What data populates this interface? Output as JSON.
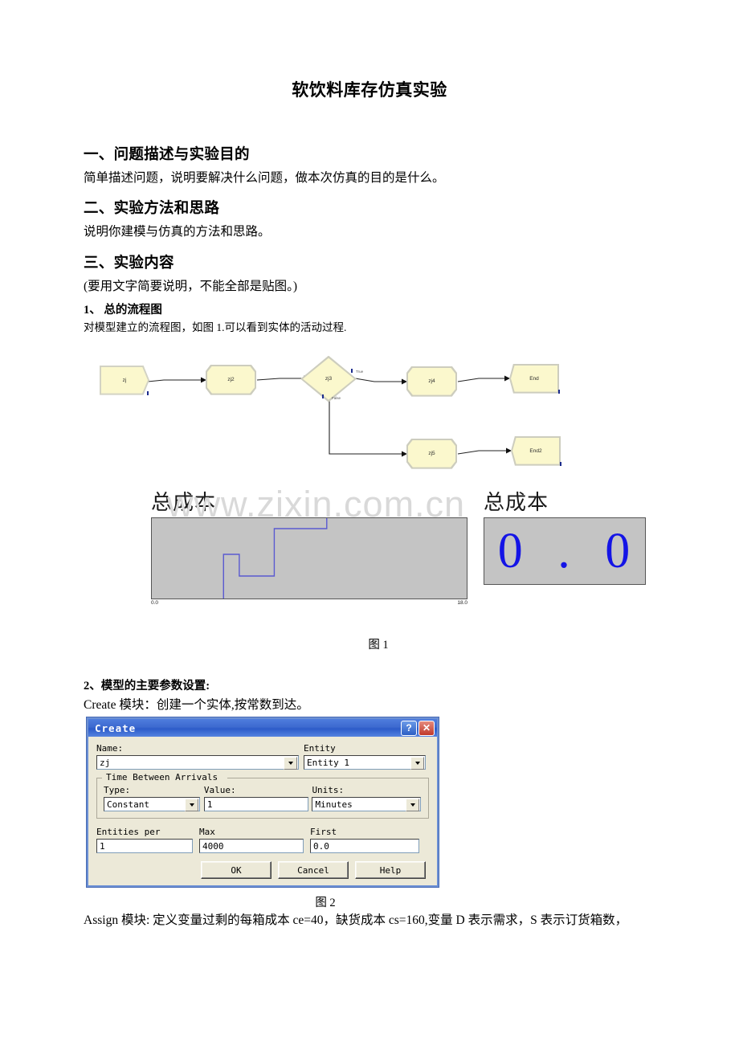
{
  "document": {
    "title": "软饮料库存仿真实验",
    "sections": [
      {
        "heading": "一、问题描述与实验目的",
        "body": "简单描述问题，说明要解决什么问题，做本次仿真的目的是什么。"
      },
      {
        "heading": "二、实验方法和思路",
        "body": "说明你建模与仿真的方法和思路。"
      },
      {
        "heading": "三、实验内容",
        "body": "(要用文字简要说明，不能全部是贴图。)"
      }
    ],
    "item1_heading": "1、  总的流程图",
    "item1_body": "对模型建立的流程图，如图 1.可以看到实体的活动过程.",
    "figure1_caption": "图 1",
    "item2_heading": "2、模型的主要参数设置:",
    "item2_body": "Create 模块：创建一个实体,按常数到达。",
    "figure2_caption": "图 2",
    "assign_body": "Assign 模块: 定义变量过剩的每箱成本 ce=40，缺货成本 cs=160,变量 D 表示需求，S 表示订货箱数，"
  },
  "watermark": "www.zixin.com.cn",
  "flowchart": {
    "nodes": [
      {
        "id": "zj",
        "label": "zj",
        "shape": "create"
      },
      {
        "id": "zj2",
        "label": "zj2",
        "shape": "octagon"
      },
      {
        "id": "zj3",
        "label": "zj3",
        "shape": "diamond"
      },
      {
        "id": "zj4",
        "label": "zj4",
        "shape": "octagon"
      },
      {
        "id": "end",
        "label": "End",
        "shape": "dispose"
      },
      {
        "id": "zj5",
        "label": "zj5",
        "shape": "octagon"
      },
      {
        "id": "end2",
        "label": "End2",
        "shape": "dispose"
      }
    ],
    "port_labels": {
      "true": "True",
      "false": "False"
    },
    "fill_color": "#fbf8cd",
    "edge_color": "#9a9a86"
  },
  "chart_data": {
    "type": "line",
    "title": "总成本",
    "xlabel": "",
    "ylabel": "",
    "xlim": [
      0.0,
      18.0
    ],
    "x_tick_labels": [
      "0.0",
      "18.0"
    ],
    "grid": false,
    "legend": "none",
    "line_color": "#5a5ad0",
    "plot_background": "#c4c4c4",
    "step": true,
    "x": [
      4.1,
      4.1,
      5.0,
      5.0,
      7.0,
      7.0,
      10.0,
      10.0
    ],
    "y": [
      0.0,
      0.55,
      0.55,
      0.28,
      0.28,
      0.87,
      0.87,
      1.0
    ],
    "series": [
      {
        "name": "总成本",
        "points": [
          {
            "x": 4.1,
            "y": 0.0
          },
          {
            "x": 4.1,
            "y": 0.55
          },
          {
            "x": 5.0,
            "y": 0.55
          },
          {
            "x": 5.0,
            "y": 0.28
          },
          {
            "x": 7.0,
            "y": 0.28
          },
          {
            "x": 7.0,
            "y": 0.87
          },
          {
            "x": 10.0,
            "y": 0.87
          },
          {
            "x": 10.0,
            "y": 1.0
          }
        ]
      }
    ]
  },
  "digital_display": {
    "title": "总成本",
    "value": "0 . 0",
    "value_color": "#1414e6",
    "background": "#c4c4c4"
  },
  "create_dialog": {
    "title": "Create",
    "help_button": "?",
    "close_button": "✕",
    "name_label": "Name:",
    "name_value": "zj",
    "entity_label": "Entity",
    "entity_value": "Entity 1",
    "group_title": "Time Between Arrivals",
    "type_label": "Type:",
    "type_value": "Constant",
    "value_label": "Value:",
    "value_value": "1",
    "units_label": "Units:",
    "units_value": "Minutes",
    "entities_per_label": "Entities per",
    "entities_per_value": "1",
    "max_label": "Max",
    "max_value": "4000",
    "first_label": "First",
    "first_value": "0.0",
    "ok_label": "OK",
    "cancel_label": "Cancel",
    "help_label": "Help"
  }
}
